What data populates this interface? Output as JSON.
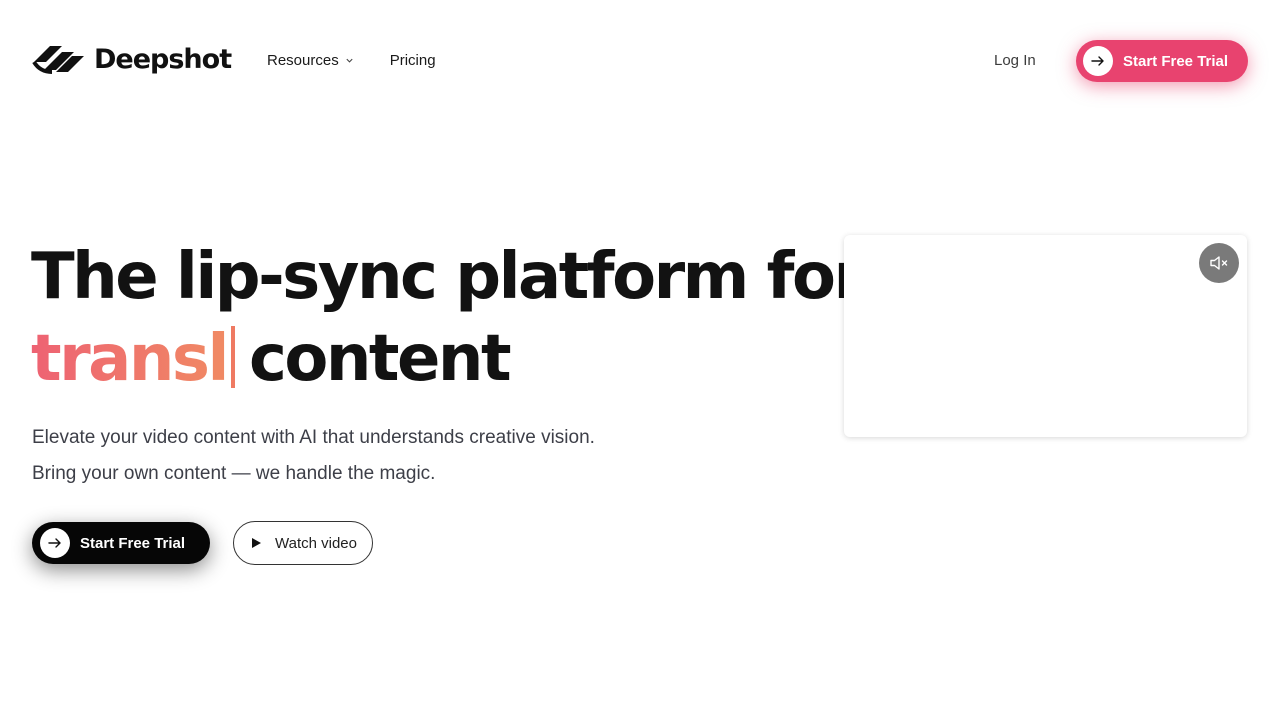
{
  "brand": {
    "name": "Deepshot",
    "logo_icon": "deepshot-wave-logo"
  },
  "nav": {
    "items": [
      {
        "label": "Resources",
        "icon": "chevron-down-icon"
      },
      {
        "label": "Pricing"
      }
    ],
    "login_label": "Log In",
    "cta_label": "Start Free Trial",
    "cta_icon": "arrow-right-icon"
  },
  "hero": {
    "headline_line1": "The lip-sync platform for",
    "typed_word": "transl",
    "headline_line2_rest": "content",
    "subtext_line1": "Elevate your video content with AI that understands creative vision.",
    "subtext_line2": "Bring your own content — we handle the magic.",
    "primary_cta_label": "Start Free Trial",
    "secondary_cta_label": "Watch video",
    "secondary_cta_icon": "play-icon"
  },
  "video": {
    "mute_icon": "speaker-muted-icon"
  },
  "colors": {
    "accent": "#e8436f",
    "gradient_start": "#ee6273",
    "gradient_end": "#f08a63",
    "dark_button": "#060606",
    "text_primary": "#121212",
    "text_secondary": "#3d3f48"
  }
}
